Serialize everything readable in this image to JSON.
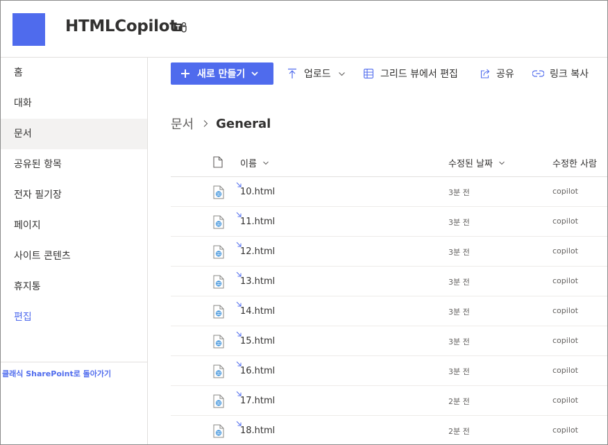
{
  "site": {
    "title": "HTMLCopilot",
    "logo_color": "#4f6bed",
    "teams_icon": "teams-icon"
  },
  "nav": {
    "items": [
      {
        "label": "홈"
      },
      {
        "label": "대화"
      },
      {
        "label": "문서",
        "active": true
      },
      {
        "label": "공유된 항목"
      },
      {
        "label": "전자 필기장"
      },
      {
        "label": "페이지"
      },
      {
        "label": "사이트 콘텐츠"
      },
      {
        "label": "휴지통"
      }
    ],
    "edit_label": "편집",
    "classic_link": "클래식 SharePoint로 돌아가기"
  },
  "toolbar": {
    "new_label": "새로 만들기",
    "upload_label": "업로드",
    "grid_label": "그리드 뷰에서 편집",
    "share_label": "공유",
    "link_label": "링크 복사"
  },
  "breadcrumb": {
    "root": "문서",
    "current": "General"
  },
  "list": {
    "columns": {
      "name": "이름",
      "modified": "수정된 날짜",
      "modified_by": "수정한 사람"
    },
    "rows": [
      {
        "name": "10.html",
        "modified": "3분 전",
        "author": "copilot"
      },
      {
        "name": "11.html",
        "modified": "3분 전",
        "author": "copilot"
      },
      {
        "name": "12.html",
        "modified": "3분 전",
        "author": "copilot"
      },
      {
        "name": "13.html",
        "modified": "3분 전",
        "author": "copilot"
      },
      {
        "name": "14.html",
        "modified": "3분 전",
        "author": "copilot"
      },
      {
        "name": "15.html",
        "modified": "3분 전",
        "author": "copilot"
      },
      {
        "name": "16.html",
        "modified": "3분 전",
        "author": "copilot"
      },
      {
        "name": "17.html",
        "modified": "2분 전",
        "author": "copilot"
      },
      {
        "name": "18.html",
        "modified": "2분 전",
        "author": "copilot"
      }
    ]
  },
  "colors": {
    "accent": "#4f6bed",
    "text": "#323130",
    "subtext": "#605e5c",
    "nav_active_bg": "#f3f2f1"
  }
}
